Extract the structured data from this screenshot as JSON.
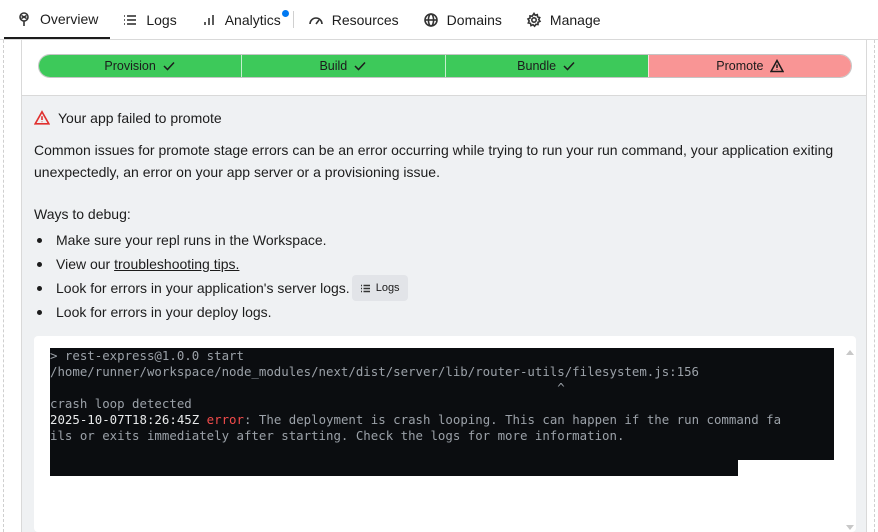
{
  "tabs": [
    {
      "label": "Overview",
      "icon": "pin-icon",
      "active": true
    },
    {
      "label": "Logs",
      "icon": "list-icon"
    },
    {
      "label": "Analytics",
      "icon": "bar-chart-icon",
      "badge": true
    },
    {
      "label": "Resources",
      "icon": "gauge-icon"
    },
    {
      "label": "Domains",
      "icon": "globe-icon"
    },
    {
      "label": "Manage",
      "icon": "gear-icon"
    }
  ],
  "stages": [
    {
      "label": "Provision",
      "status": "success"
    },
    {
      "label": "Build",
      "status": "success"
    },
    {
      "label": "Bundle",
      "status": "success"
    },
    {
      "label": "Promote",
      "status": "failed"
    }
  ],
  "colors": {
    "success": "#3dc95a",
    "failed": "#f99595",
    "error_accent": "#e0312f",
    "badge": "#0079f2"
  },
  "error": {
    "title": "Your app failed to promote",
    "description": "Common issues for promote stage errors can be an error occurring while trying to run your run command, your application exiting unexpectedly, an error on your app server or a provisioning issue.",
    "ways_heading": "Ways to debug:",
    "bullet_1": "Make sure your repl runs in the Workspace.",
    "bullet_2_prefix": "View our ",
    "bullet_2_link": "troubleshooting tips.",
    "bullet_3": "Look for errors in your application's server logs.",
    "logs_button": "Logs",
    "bullet_4": "Look for errors in your deploy logs."
  },
  "terminal": {
    "line1": "> rest-express@1.0.0 start",
    "line2": "/home/runner/workspace/node_modules/next/dist/server/lib/router-utils/filesystem.js:156",
    "line3": "                                                                    ^",
    "line4": "crash loop detected",
    "timestamp": "2025-10-07T18:26:45Z",
    "level": "error",
    "message_1": ": The deployment is crash looping. This can happen if the run command fa",
    "message_2": "ils or exits immediately after starting. Check the logs for more information."
  }
}
